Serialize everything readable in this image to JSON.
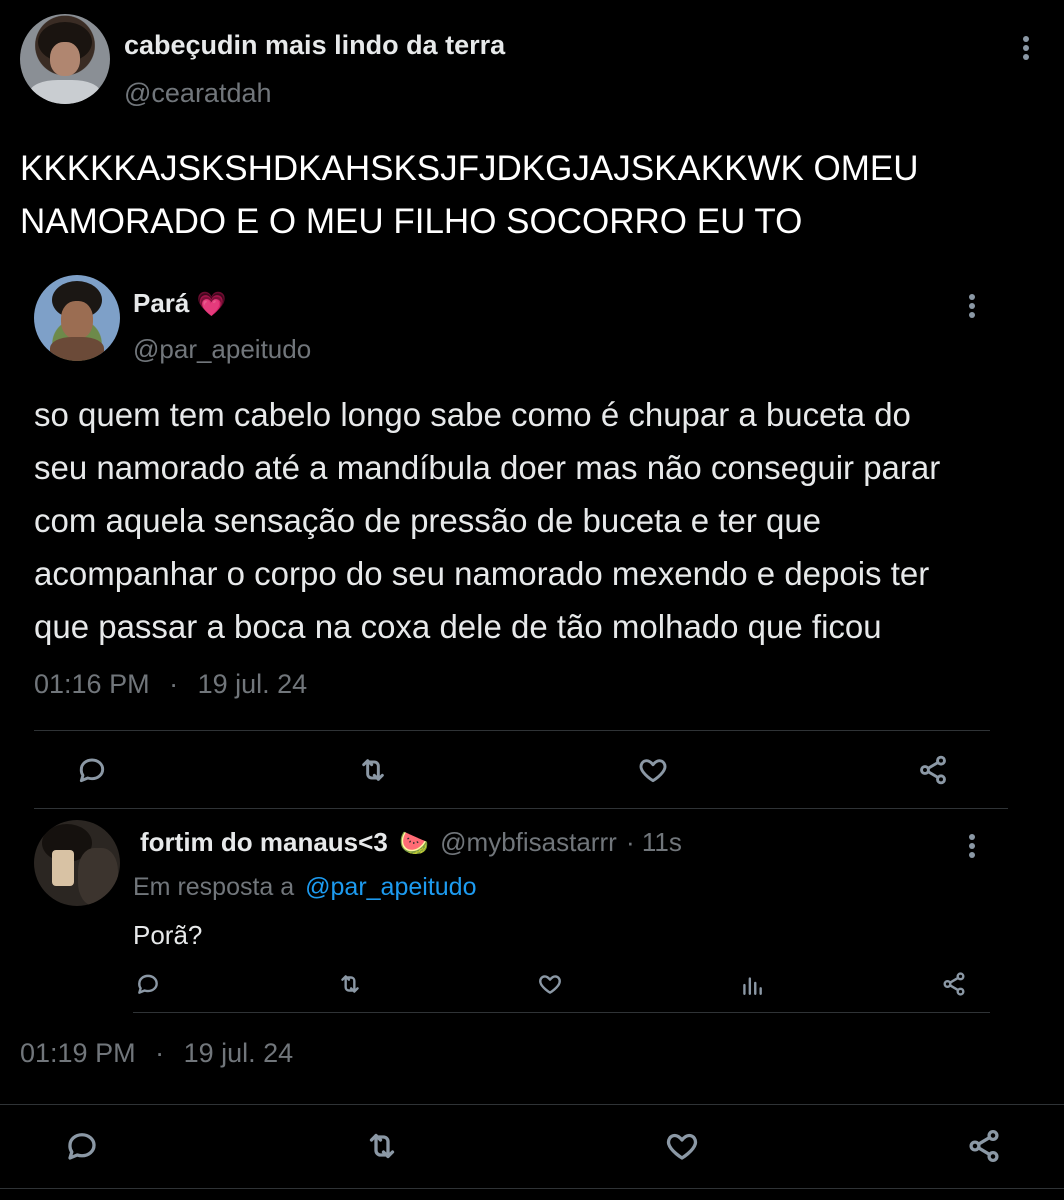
{
  "main_tweet": {
    "display_name": "cabeçudin mais lindo da terra",
    "handle": "@cearatdah",
    "text_line1": "KKKKKAJSKSHDKAHSKSJFJDKGJAJSKAKKWK OMEU",
    "text_line2": "NAMORADO E O MEU FILHO SOCORRO EU TO",
    "time": "01:19 PM",
    "separator": "·",
    "date": "19 jul. 24"
  },
  "quoted_tweet": {
    "display_name": "Pará",
    "emoji": "💗",
    "handle": "@par_apeitudo",
    "lines": [
      "so quem tem cabelo longo sabe como é chupar a buceta do",
      "seu namorado até a mandíbula doer mas não conseguir parar",
      "com aquela sensação de pressão de buceta e ter que",
      "acompanhar o corpo do seu namorado mexendo e depois ter",
      "que passar a boca na coxa dele de tão molhado que ficou"
    ],
    "time": "01:16 PM",
    "separator": "·",
    "date": "19 jul. 24"
  },
  "reply": {
    "display_name": "fortim do manaus<3",
    "emoji": "🍉",
    "handle": "@mybfisastarrr",
    "meta": "· 11s",
    "replying_prefix": "Em resposta a",
    "replying_to": "@par_apeitudo",
    "text": "Porã?"
  },
  "icons": {
    "reply": "reply-icon",
    "retweet": "retweet-icon",
    "like": "heart-icon",
    "share": "share-icon",
    "views": "analytics-icon",
    "more": "more-icon"
  },
  "colors": {
    "background": "#000000",
    "text": "#e7e9ea",
    "muted": "#71767b",
    "link": "#1d9bf0",
    "divider": "#2f3336"
  }
}
